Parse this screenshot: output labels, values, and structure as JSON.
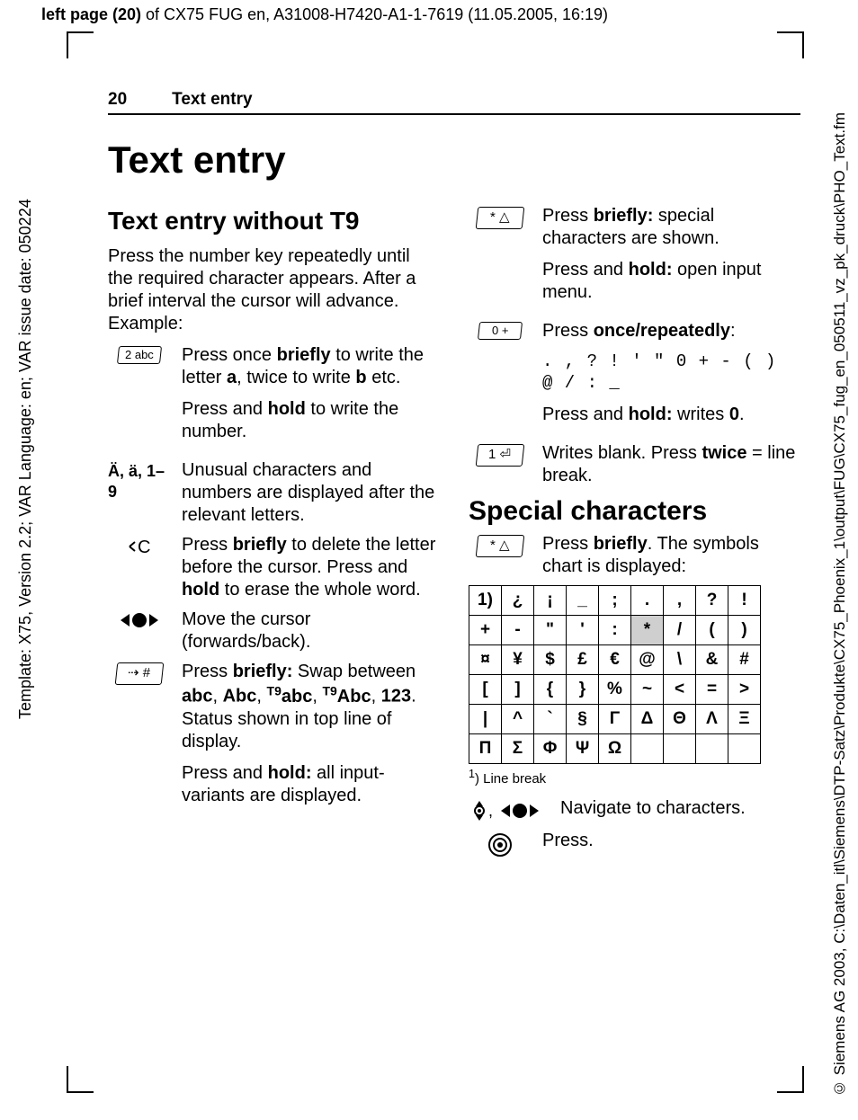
{
  "meta": {
    "top_note_prefix": "left page (20)",
    "top_note_rest": " of CX75 FUG en, A31008-H7420-A1-1-7619 (11.05.2005, 16:19)",
    "left_note": "Template: X75, Version 2.2; VAR Language: en; VAR issue date: 050224",
    "right_note": "© Siemens AG 2003, C:\\Daten_itl\\Siemens\\DTP-Satz\\Produkte\\CX75_Phoenix_1\\output\\FUG\\CX75_fug_en_050511_vz_pk_druck\\PHO_Text.fm"
  },
  "header": {
    "page_no": "20",
    "section": "Text entry"
  },
  "title": "Text entry",
  "left": {
    "h2": "Text entry without T9",
    "intro": "Press the number key repeatedly until the required character appears. After a brief interval the cursor will advance. Example:",
    "key2_label": "2 abc",
    "key2_a": "Press once ",
    "key2_b": "briefly",
    "key2_c": " to write the letter ",
    "key2_d": "a",
    "key2_e": ", twice to write ",
    "key2_f": "b",
    "key2_g": " etc.",
    "key2_hold_a": "Press and ",
    "key2_hold_b": "hold",
    "key2_hold_c": " to write the number.",
    "unusual_label": "Ä, ä, 1–9",
    "unusual_text": "Unusual characters and numbers are displayed after the relevant letters.",
    "del_a": "Press ",
    "del_b": "briefly",
    "del_c": " to delete the letter before the cursor. Press and ",
    "del_d": "hold",
    "del_e": " to erase the whole word.",
    "move_text": "Move the cursor (forwards/back).",
    "hash_label": "#",
    "hash_a": "Press ",
    "hash_b": "briefly:",
    "hash_c": " Swap between ",
    "hash_d": "abc",
    "hash_e": ", ",
    "hash_f": "Abc",
    "hash_g": ", ",
    "hash_t9a": "T9",
    "hash_h": "abc",
    "hash_i": ", ",
    "hash_t9b": "T9",
    "hash_j": "Abc",
    "hash_k": ", ",
    "hash_l": "123",
    "hash_m": ". Status shown in top line of display.",
    "hash_hold_a": "Press and ",
    "hash_hold_b": "hold:",
    "hash_hold_c": " all input-variants are displayed."
  },
  "right": {
    "star_a": "Press ",
    "star_b": "briefly:",
    "star_c": " special characters are shown.",
    "star_hold_a": "Press and ",
    "star_hold_b": "hold:",
    "star_hold_c": " open input menu.",
    "zero_label": "0 +",
    "zero_a": "Press ",
    "zero_b": "once/repeatedly",
    "zero_c": ":",
    "zero_chars": ". , ? ! ' \" 0 + - ( ) @ / : _",
    "zero_hold_a": "Press and ",
    "zero_hold_b": "hold:",
    "zero_hold_c": " writes ",
    "zero_hold_d": "0",
    "zero_hold_e": ".",
    "one_label": "1 ▱",
    "one_a": "Writes blank. Press ",
    "one_b": "twice",
    "one_c": " = line break.",
    "h2": "Special characters",
    "sc_a": "Press ",
    "sc_b": "briefly",
    "sc_c": ". The symbols chart is displayed:",
    "table": [
      [
        "1)",
        "¿",
        "¡",
        "_",
        ";",
        ".",
        ",",
        "?",
        "!"
      ],
      [
        "+",
        "-",
        "\"",
        "'",
        ":",
        "*",
        "/",
        "(",
        ")"
      ],
      [
        "¤",
        "¥",
        "$",
        "£",
        "€",
        "@",
        "\\",
        "&",
        "#"
      ],
      [
        "[",
        "]",
        "{",
        "}",
        "%",
        "~",
        "<",
        "=",
        ">"
      ],
      [
        "|",
        "^",
        "`",
        "§",
        "Γ",
        "Δ",
        "Θ",
        "Λ",
        "Ξ"
      ],
      [
        "Π",
        "Σ",
        "Φ",
        "Ψ",
        "Ω",
        "",
        "",
        "",
        ""
      ]
    ],
    "table_highlight": {
      "row": 1,
      "col": 5
    },
    "footnote": "1) Line break",
    "nav_text": "Navigate to characters.",
    "press_text": "Press."
  }
}
